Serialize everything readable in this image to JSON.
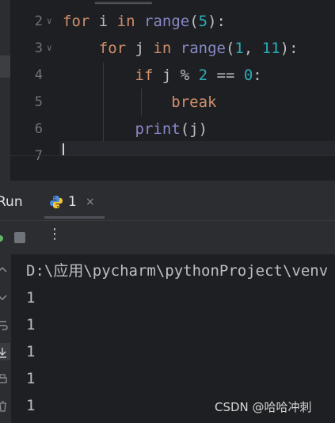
{
  "editor": {
    "top_partial_text": "▁▁▁▁▁▁▁",
    "lines": [
      {
        "number": "2",
        "tokens": [
          {
            "t": "for",
            "c": "kw"
          },
          {
            "t": " i ",
            "c": "id"
          },
          {
            "t": "in",
            "c": "kw"
          },
          {
            "t": " ",
            "c": "id"
          },
          {
            "t": "range",
            "c": "fn"
          },
          {
            "t": "(",
            "c": "id"
          },
          {
            "t": "5",
            "c": "num"
          },
          {
            "t": "):",
            "c": "id"
          }
        ]
      },
      {
        "number": "3",
        "tokens": [
          {
            "t": "    ",
            "c": "id"
          },
          {
            "t": "for",
            "c": "kw"
          },
          {
            "t": " j ",
            "c": "id"
          },
          {
            "t": "in",
            "c": "kw"
          },
          {
            "t": " ",
            "c": "id"
          },
          {
            "t": "range",
            "c": "fn"
          },
          {
            "t": "(",
            "c": "id"
          },
          {
            "t": "1",
            "c": "num"
          },
          {
            "t": ", ",
            "c": "id"
          },
          {
            "t": "11",
            "c": "num"
          },
          {
            "t": "):",
            "c": "id"
          }
        ]
      },
      {
        "number": "4",
        "tokens": [
          {
            "t": "        ",
            "c": "id"
          },
          {
            "t": "if",
            "c": "kw"
          },
          {
            "t": " j % ",
            "c": "id"
          },
          {
            "t": "2",
            "c": "num"
          },
          {
            "t": " == ",
            "c": "id"
          },
          {
            "t": "0",
            "c": "num"
          },
          {
            "t": ":",
            "c": "id"
          }
        ]
      },
      {
        "number": "5",
        "tokens": [
          {
            "t": "            ",
            "c": "id"
          },
          {
            "t": "break",
            "c": "kw"
          }
        ]
      },
      {
        "number": "6",
        "tokens": [
          {
            "t": "        ",
            "c": "id"
          },
          {
            "t": "print",
            "c": "fn"
          },
          {
            "t": "(j)",
            "c": "id"
          }
        ]
      },
      {
        "number": "7",
        "tokens": []
      }
    ]
  },
  "run_panel": {
    "title": "Run",
    "tab_label": "1",
    "tab_close": "×",
    "more_icon": "⋮"
  },
  "console": {
    "path_line": "D:\\应用\\pycharm\\pythonProject\\venv",
    "output": [
      "1",
      "1",
      "1",
      "1",
      "1"
    ]
  },
  "watermark": "CSDN @哈哈冲刺",
  "colors": {
    "keyword": "#cf8e6d",
    "builtin": "#8888c6",
    "number": "#2aacb8",
    "text": "#bcbec4"
  }
}
